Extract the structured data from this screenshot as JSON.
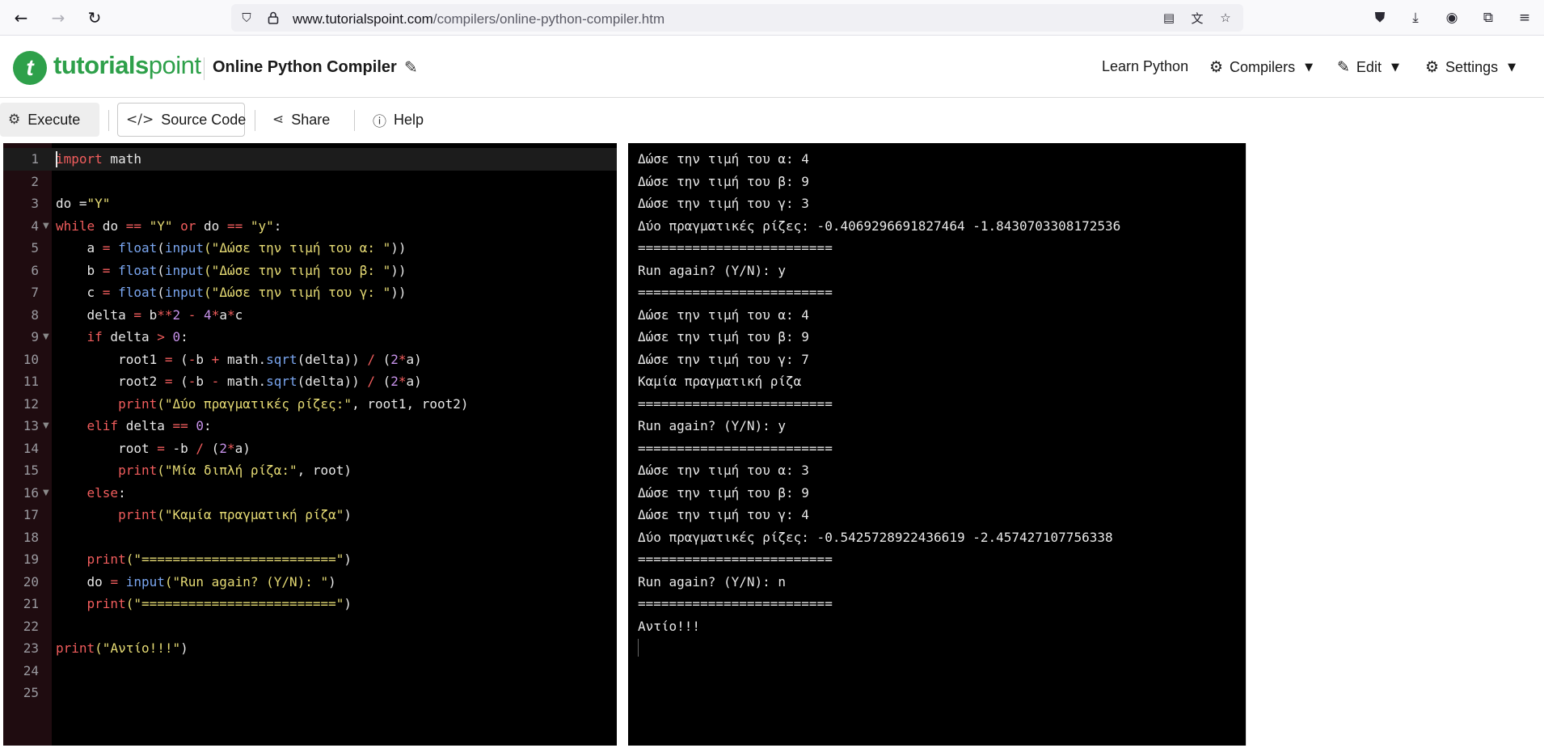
{
  "browser": {
    "url_host": "www.tutorialspoint.com",
    "url_path": "/compilers/online-python-compiler.htm"
  },
  "header": {
    "logo_bold": "tutorials",
    "logo_light": "point",
    "logo_mark": "t",
    "title": "Online Python Compiler",
    "nav": {
      "learn": "Learn Python",
      "compilers": "Compilers",
      "edit": "Edit",
      "settings": "Settings"
    }
  },
  "toolbar": {
    "execute": "Execute",
    "source_code": "Source Code",
    "share": "Share",
    "help": "Help"
  },
  "editor": {
    "line_numbers": [
      "1",
      "2",
      "3",
      "4",
      "5",
      "6",
      "7",
      "8",
      "9",
      "10",
      "11",
      "12",
      "13",
      "14",
      "15",
      "16",
      "17",
      "18",
      "19",
      "20",
      "21",
      "22",
      "23",
      "24",
      "25"
    ],
    "fold_lines": [
      4,
      9,
      13,
      16
    ],
    "tokens": {
      "l1_kw": "import",
      "l1_rest": " math",
      "l3_a": "do =",
      "l3_s": "\"Y\"",
      "l4_kw": "while",
      "l4_a": " do ",
      "l4_op1": "==",
      "l4_s1": " \"Y\" ",
      "l4_kw2": "or",
      "l4_b": " do ",
      "l4_op2": "==",
      "l4_s2": " \"y\"",
      "l4_c": ":",
      "l5_a": "    a ",
      "l5_op": "=",
      "l5_fn1": " float",
      "l5_p": "(",
      "l5_fn2": "input",
      "l5_s": "(\"Δώσε την τιμή του α: \"",
      "l5_e": "))",
      "l6_a": "    b ",
      "l6_s": "(\"Δώσε την τιμή του β: \"",
      "l7_a": "    c ",
      "l7_s": "(\"Δώσε την τιμή του γ: \"",
      "l8_a": "    delta ",
      "l8_b": " b",
      "l8_op2": "**",
      "l8_n1": "2",
      "l8_op3": " - ",
      "l8_n2": "4",
      "l8_op4": "*",
      "l8_c": "a",
      "l8_d": "c",
      "l9_kw": "    if",
      "l9_a": " delta ",
      "l9_op": ">",
      "l9_n": " 0",
      "l9_c": ":",
      "l10_a": "        root1 ",
      "l10_b": " (",
      "l10_op2": "-",
      "l10_c": "b ",
      "l10_op3": "+",
      "l10_d": " math.",
      "l10_fn": "sqrt",
      "l10_e": "(delta)) ",
      "l10_op4": "/",
      "l10_f": " (",
      "l10_n": "2",
      "l10_op5": "*",
      "l10_g": "a)",
      "l11_a": "        root2 ",
      "l11_op3": "-",
      "l12_fn": "        print",
      "l12_s": "(\"Δύο πραγματικές ρίζες:\"",
      "l12_e": ", root1, root2)",
      "l13_kw": "    elif",
      "l13_a": " delta ",
      "l13_op": "==",
      "l13_n": " 0",
      "l13_c": ":",
      "l14_a": "        root ",
      "l14_b": " -b ",
      "l14_c": " (",
      "l14_d": "a)",
      "l15_fn": "        print",
      "l15_s": "(\"Μία διπλή ρίζα:\"",
      "l15_e": ", root)",
      "l16_kw": "    else",
      "l16_c": ":",
      "l17_fn": "        print",
      "l17_s": "(\"Καμία πραγματική ρίζα\"",
      "l17_e": ")",
      "l19_fn": "    print",
      "l19_s": "(\"=========================\"",
      "l19_e": ")",
      "l20_a": "    do ",
      "l20_fn": " input",
      "l20_s": "(\"Run again? (Y/N): \"",
      "l20_e": ")",
      "l23_fn": "print",
      "l23_s": "(\"Αντίο!!!\"",
      "l23_e": ")"
    }
  },
  "output": {
    "lines": [
      "Δώσε την τιμή του α: 4",
      "Δώσε την τιμή του β: 9",
      "Δώσε την τιμή του γ: 3",
      "Δύο πραγματικές ρίζες: -0.4069296691827464 -1.8430703308172536",
      "=========================",
      "Run again? (Y/N): y",
      "=========================",
      "Δώσε την τιμή του α: 4",
      "Δώσε την τιμή του β: 9",
      "Δώσε την τιμή του γ: 7",
      "Καμία πραγματική ρίζα",
      "=========================",
      "Run again? (Y/N): y",
      "=========================",
      "Δώσε την τιμή του α: 3",
      "Δώσε την τιμή του β: 9",
      "Δώσε την τιμή του γ: 4",
      "Δύο πραγματικές ρίζες: -0.5425728922436619 -2.457427107756338",
      "=========================",
      "Run again? (Y/N): n",
      "=========================",
      "Αντίο!!!"
    ]
  },
  "icons": {
    "back": "arrow-left-icon",
    "forward": "arrow-right-icon",
    "reload": "reload-icon",
    "shield": "shield-icon",
    "lock": "lock-icon",
    "reader": "reader-view-icon",
    "translate": "translate-icon",
    "bookmark": "star-icon",
    "pocket": "pocket-icon",
    "download": "download-icon",
    "account": "account-icon",
    "extensions": "puzzle-icon",
    "menu": "hamburger-menu-icon"
  }
}
